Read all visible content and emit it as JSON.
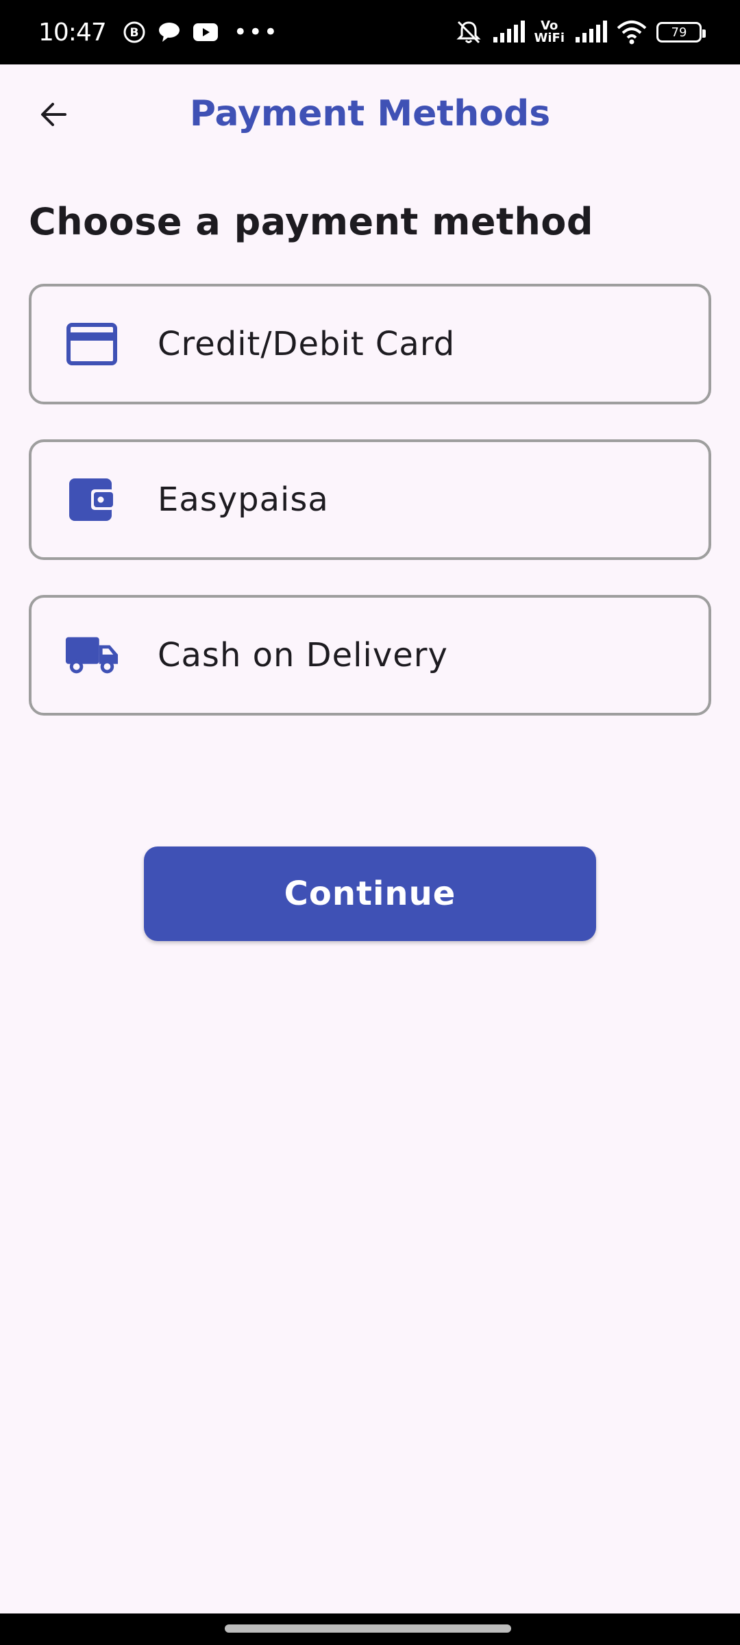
{
  "status_bar": {
    "time": "10:47",
    "battery": "79",
    "vowifi_top": "Vo",
    "vowifi_bottom": "WiFi",
    "icons": [
      "b-icon",
      "chat-icon",
      "youtube-icon",
      "more-dots-icon",
      "bell-muted-icon",
      "signal-icon",
      "vowifi-icon",
      "signal-icon",
      "wifi-icon",
      "battery-icon"
    ]
  },
  "header": {
    "title": "Payment Methods",
    "back_icon": "arrow-left-icon"
  },
  "main": {
    "heading": "Choose a payment method",
    "options": [
      {
        "label": "Credit/Debit Card",
        "icon": "credit-card-icon"
      },
      {
        "label": "Easypaisa",
        "icon": "wallet-icon"
      },
      {
        "label": "Cash on Delivery",
        "icon": "truck-icon"
      }
    ],
    "continue_label": "Continue"
  },
  "colors": {
    "accent": "#3f51b5",
    "background": "#fcf5fc",
    "text": "#1d1b20",
    "border": "#9e9e9e"
  }
}
